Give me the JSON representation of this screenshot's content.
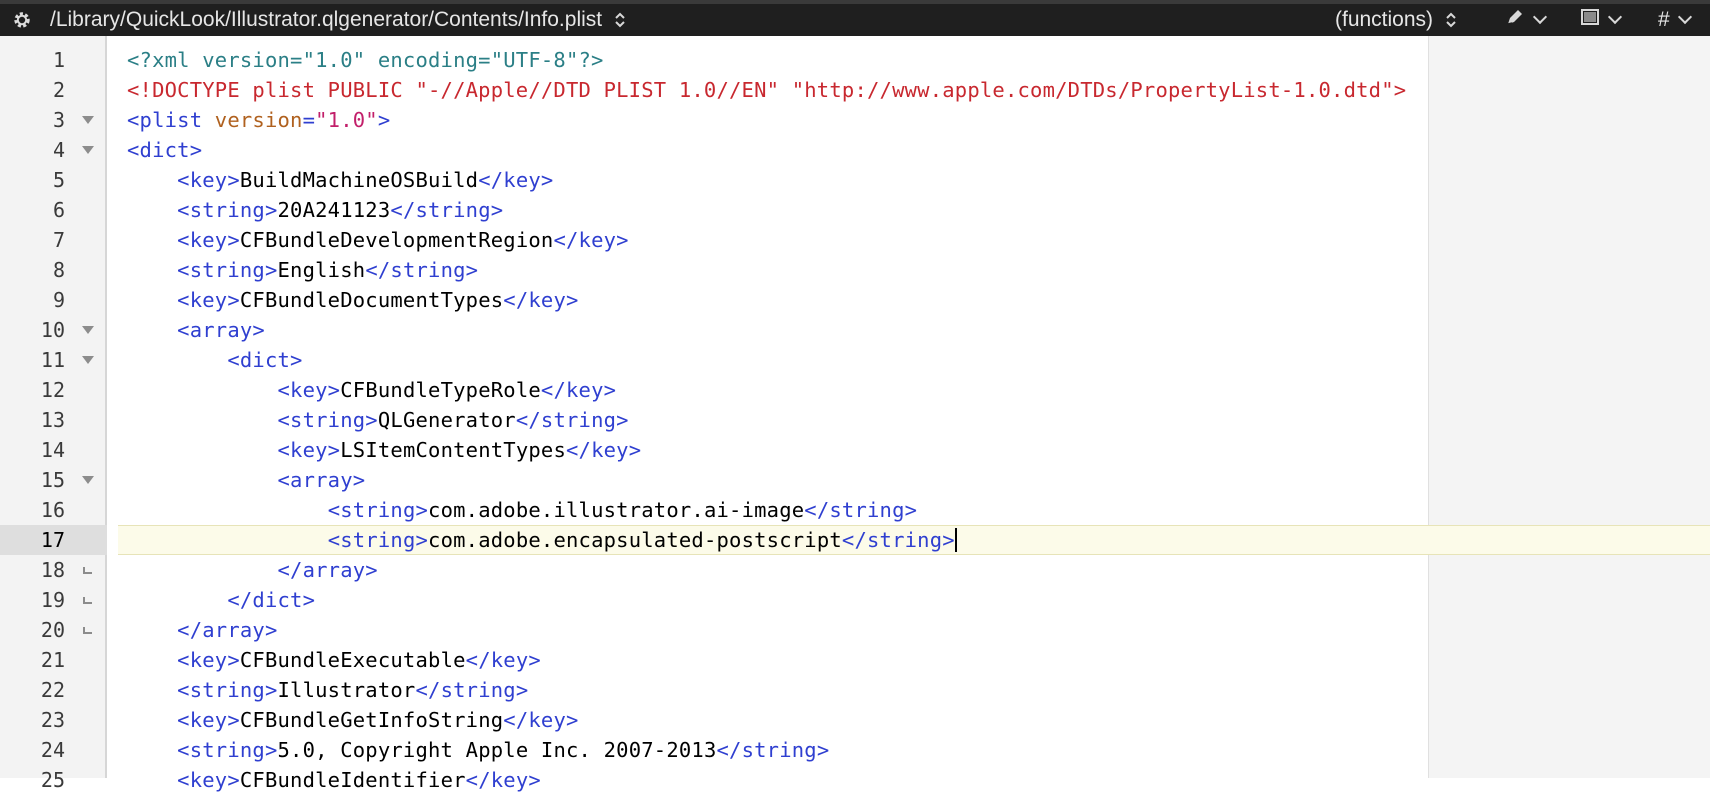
{
  "toolbar": {
    "path": "/Library/QuickLook/Illustrator.qlgenerator/Contents/Info.plist",
    "functions_label": "(functions)",
    "hash_label": "#",
    "icons": [
      "gear-icon",
      "updown-chevron-icon",
      "pen-icon",
      "window-icon",
      "chevron-down-icon"
    ]
  },
  "editor": {
    "current_line": 17,
    "lines": [
      {
        "num": "1",
        "fold": "",
        "segs": [
          {
            "c": "t-pi",
            "t": "<?xml version=\"1.0\" encoding=\"UTF-8\"?>"
          }
        ]
      },
      {
        "num": "2",
        "fold": "",
        "segs": [
          {
            "c": "t-doc",
            "t": "<!DOCTYPE plist PUBLIC \"-//Apple//DTD PLIST 1.0//EN\" \"http://www.apple.com/DTDs/PropertyList-1.0.dtd\">"
          }
        ]
      },
      {
        "num": "3",
        "fold": "open",
        "segs": [
          {
            "c": "t-tag",
            "t": "<plist "
          },
          {
            "c": "t-attr",
            "t": "version"
          },
          {
            "c": "t-tag",
            "t": "="
          },
          {
            "c": "t-str",
            "t": "\"1.0\""
          },
          {
            "c": "t-tag",
            "t": ">"
          }
        ]
      },
      {
        "num": "4",
        "fold": "open",
        "segs": [
          {
            "c": "t-tag",
            "t": "<dict>"
          }
        ]
      },
      {
        "num": "5",
        "fold": "",
        "segs": [
          {
            "c": "t-txt",
            "t": "    "
          },
          {
            "c": "t-tag",
            "t": "<key>"
          },
          {
            "c": "t-txt",
            "t": "BuildMachineOSBuild"
          },
          {
            "c": "t-tag",
            "t": "</key>"
          }
        ]
      },
      {
        "num": "6",
        "fold": "",
        "segs": [
          {
            "c": "t-txt",
            "t": "    "
          },
          {
            "c": "t-tag",
            "t": "<string>"
          },
          {
            "c": "t-txt",
            "t": "20A241123"
          },
          {
            "c": "t-tag",
            "t": "</string>"
          }
        ]
      },
      {
        "num": "7",
        "fold": "",
        "segs": [
          {
            "c": "t-txt",
            "t": "    "
          },
          {
            "c": "t-tag",
            "t": "<key>"
          },
          {
            "c": "t-txt",
            "t": "CFBundleDevelopmentRegion"
          },
          {
            "c": "t-tag",
            "t": "</key>"
          }
        ]
      },
      {
        "num": "8",
        "fold": "",
        "segs": [
          {
            "c": "t-txt",
            "t": "    "
          },
          {
            "c": "t-tag",
            "t": "<string>"
          },
          {
            "c": "t-txt",
            "t": "English"
          },
          {
            "c": "t-tag",
            "t": "</string>"
          }
        ]
      },
      {
        "num": "9",
        "fold": "",
        "segs": [
          {
            "c": "t-txt",
            "t": "    "
          },
          {
            "c": "t-tag",
            "t": "<key>"
          },
          {
            "c": "t-txt",
            "t": "CFBundleDocumentTypes"
          },
          {
            "c": "t-tag",
            "t": "</key>"
          }
        ]
      },
      {
        "num": "10",
        "fold": "open",
        "segs": [
          {
            "c": "t-txt",
            "t": "    "
          },
          {
            "c": "t-tag",
            "t": "<array>"
          }
        ]
      },
      {
        "num": "11",
        "fold": "open",
        "segs": [
          {
            "c": "t-txt",
            "t": "        "
          },
          {
            "c": "t-tag",
            "t": "<dict>"
          }
        ]
      },
      {
        "num": "12",
        "fold": "",
        "segs": [
          {
            "c": "t-txt",
            "t": "            "
          },
          {
            "c": "t-tag",
            "t": "<key>"
          },
          {
            "c": "t-txt",
            "t": "CFBundleTypeRole"
          },
          {
            "c": "t-tag",
            "t": "</key>"
          }
        ]
      },
      {
        "num": "13",
        "fold": "",
        "segs": [
          {
            "c": "t-txt",
            "t": "            "
          },
          {
            "c": "t-tag",
            "t": "<string>"
          },
          {
            "c": "t-txt",
            "t": "QLGenerator"
          },
          {
            "c": "t-tag",
            "t": "</string>"
          }
        ]
      },
      {
        "num": "14",
        "fold": "",
        "segs": [
          {
            "c": "t-txt",
            "t": "            "
          },
          {
            "c": "t-tag",
            "t": "<key>"
          },
          {
            "c": "t-txt",
            "t": "LSItemContentTypes"
          },
          {
            "c": "t-tag",
            "t": "</key>"
          }
        ]
      },
      {
        "num": "15",
        "fold": "open",
        "segs": [
          {
            "c": "t-txt",
            "t": "            "
          },
          {
            "c": "t-tag",
            "t": "<array>"
          }
        ]
      },
      {
        "num": "16",
        "fold": "",
        "segs": [
          {
            "c": "t-txt",
            "t": "                "
          },
          {
            "c": "t-tag",
            "t": "<string>"
          },
          {
            "c": "t-txt",
            "t": "com.adobe.illustrator.ai-image"
          },
          {
            "c": "t-tag",
            "t": "</string>"
          }
        ]
      },
      {
        "num": "17",
        "fold": "",
        "segs": [
          {
            "c": "t-txt",
            "t": "                "
          },
          {
            "c": "t-tag",
            "t": "<string>"
          },
          {
            "c": "t-txt",
            "t": "com.adobe.encapsulated-postscript"
          },
          {
            "c": "t-tag",
            "t": "</string>"
          }
        ]
      },
      {
        "num": "18",
        "fold": "end",
        "segs": [
          {
            "c": "t-txt",
            "t": "            "
          },
          {
            "c": "t-tag",
            "t": "</array>"
          }
        ]
      },
      {
        "num": "19",
        "fold": "end",
        "segs": [
          {
            "c": "t-txt",
            "t": "        "
          },
          {
            "c": "t-tag",
            "t": "</dict>"
          }
        ]
      },
      {
        "num": "20",
        "fold": "end",
        "segs": [
          {
            "c": "t-txt",
            "t": "    "
          },
          {
            "c": "t-tag",
            "t": "</array>"
          }
        ]
      },
      {
        "num": "21",
        "fold": "",
        "segs": [
          {
            "c": "t-txt",
            "t": "    "
          },
          {
            "c": "t-tag",
            "t": "<key>"
          },
          {
            "c": "t-txt",
            "t": "CFBundleExecutable"
          },
          {
            "c": "t-tag",
            "t": "</key>"
          }
        ]
      },
      {
        "num": "22",
        "fold": "",
        "segs": [
          {
            "c": "t-txt",
            "t": "    "
          },
          {
            "c": "t-tag",
            "t": "<string>"
          },
          {
            "c": "t-txt",
            "t": "Illustrator"
          },
          {
            "c": "t-tag",
            "t": "</string>"
          }
        ]
      },
      {
        "num": "23",
        "fold": "",
        "segs": [
          {
            "c": "t-txt",
            "t": "    "
          },
          {
            "c": "t-tag",
            "t": "<key>"
          },
          {
            "c": "t-txt",
            "t": "CFBundleGetInfoString"
          },
          {
            "c": "t-tag",
            "t": "</key>"
          }
        ]
      },
      {
        "num": "24",
        "fold": "",
        "segs": [
          {
            "c": "t-txt",
            "t": "    "
          },
          {
            "c": "t-tag",
            "t": "<string>"
          },
          {
            "c": "t-txt",
            "t": "5.0, Copyright Apple Inc. 2007-2013"
          },
          {
            "c": "t-tag",
            "t": "</string>"
          }
        ]
      },
      {
        "num": "25",
        "fold": "",
        "segs": [
          {
            "c": "t-txt",
            "t": "    "
          },
          {
            "c": "t-tag",
            "t": "<key>"
          },
          {
            "c": "t-txt",
            "t": "CFBundleIdentifier"
          },
          {
            "c": "t-tag",
            "t": "</key>"
          }
        ]
      }
    ]
  },
  "colors": {
    "tag": "#2f3fd0",
    "doctype": "#c8282f",
    "attr": "#b0611f",
    "string": "#c21f6a",
    "pi": "#2b7f86",
    "toolbar_bg": "#1f1f1f",
    "current_line_bg": "#fcfbe9"
  }
}
